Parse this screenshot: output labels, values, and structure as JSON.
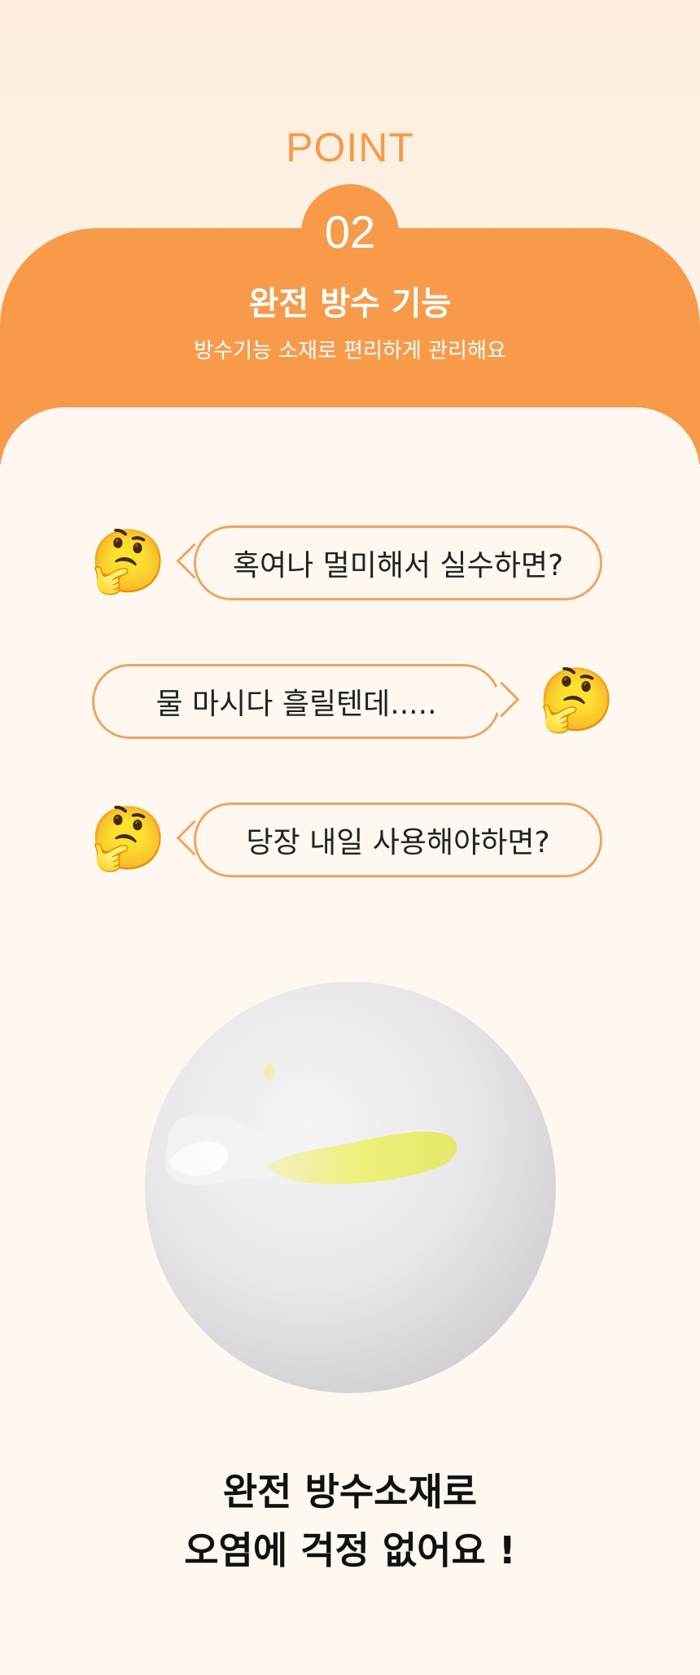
{
  "header": {
    "point_label": "POINT",
    "number": "02",
    "title": "완전 방수 기능",
    "subtitle": "방수기능 소재로 편리하게 관리해요"
  },
  "bubbles": [
    {
      "emoji": "🤔",
      "text": "혹여나 멀미해서 실수하면?"
    },
    {
      "emoji": "🤔",
      "text": "물 마시다 흘릴텐데....."
    },
    {
      "emoji": "🤔",
      "text": "당장 내일 사용해야하면?"
    }
  ],
  "bottom": {
    "line1": "완전 방수소재로",
    "line2": "오염에 걱정 없어요 !"
  },
  "colors": {
    "accent": "#f79b4b",
    "bubble_border": "#f0a55f",
    "background": "#fef8f0"
  }
}
